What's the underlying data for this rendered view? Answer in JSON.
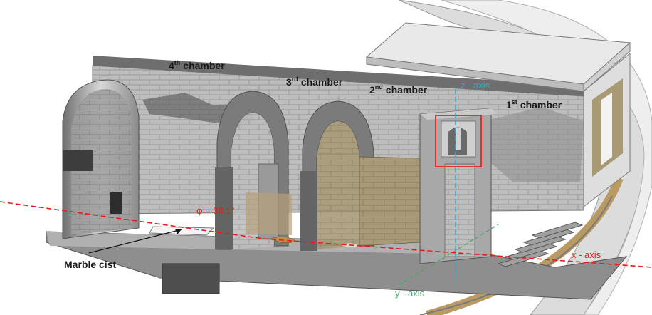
{
  "labels": {
    "chamber4": {
      "num": "4",
      "sup": "th",
      "word": "chamber"
    },
    "chamber3": {
      "num": "3",
      "sup": "rd",
      "word": "chamber"
    },
    "chamber2": {
      "num": "2",
      "sup": "nd",
      "word": "chamber"
    },
    "chamber1": {
      "num": "1",
      "sup": "st",
      "word": "chamber"
    },
    "marble_cist": "Marble cist",
    "phi": "φ = 38.1°"
  },
  "axes": {
    "z": {
      "label": "z - axis",
      "color": "#3aa7c9"
    },
    "x": {
      "label": "x - axis",
      "color": "#e02020"
    },
    "y": {
      "label": "y - axis",
      "color": "#4aa86a"
    }
  },
  "colors": {
    "stone_light": "#c9c9c9",
    "stone_mid": "#9a9a9a",
    "stone_dark": "#5a5a5a",
    "tan_ground": "#b59a6a",
    "highlight_box": "#e03030"
  }
}
